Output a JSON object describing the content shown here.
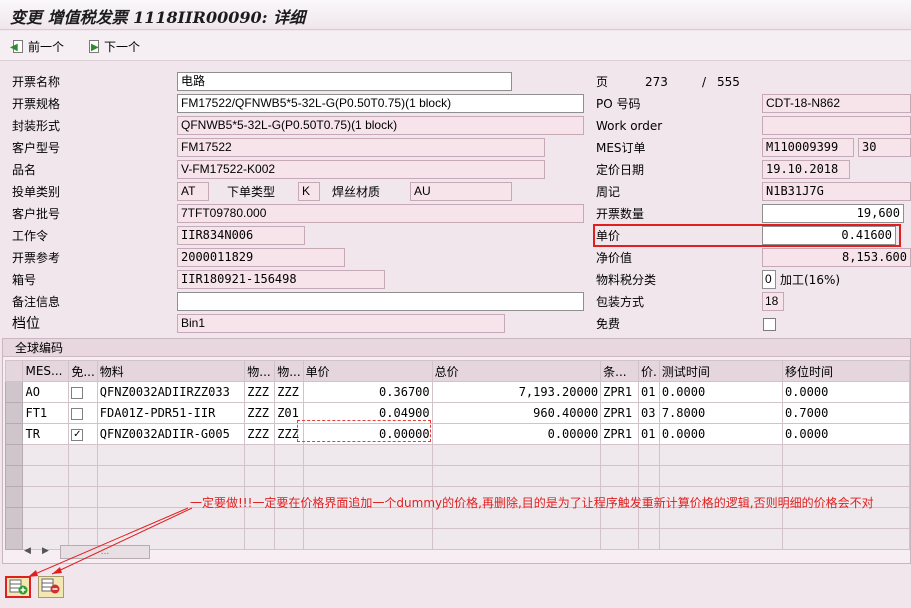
{
  "window": {
    "title": "变更 增值税发票 1118IIR00090: 详细"
  },
  "toolbar": {
    "prev_label": "前一个",
    "next_label": "下一个"
  },
  "form": {
    "invoice_name": {
      "label": "开票名称",
      "value": "电路"
    },
    "invoice_spec": {
      "label": "开票规格",
      "value": "FM17522/QFNWB5*5-32L-G(P0.50T0.75)(1 block)"
    },
    "package_form": {
      "label": "封装形式",
      "value": "QFNWB5*5-32L-G(P0.50T0.75)(1 block)"
    },
    "customer_model": {
      "label": "客户型号",
      "value": "FM17522"
    },
    "product_name": {
      "label": "品名",
      "value": "V-FM17522-K002"
    },
    "order_type": {
      "label": "投单类别",
      "value": "AT",
      "sub_label": "下单类型",
      "sub_value": "K",
      "wire_label": "焊丝材质",
      "wire_value": "AU"
    },
    "customer_batch": {
      "label": "客户批号",
      "value": "7TFT09780.000"
    },
    "work_order": {
      "label": "工作令",
      "value": "IIR834N006"
    },
    "invoice_ref": {
      "label": "开票参考",
      "value": "2000011829"
    },
    "box_no": {
      "label": "箱号",
      "value": "IIR180921-156498"
    },
    "remarks": {
      "label": "备注信息",
      "value": ""
    },
    "bin": {
      "label": "档位",
      "value": "Bin1"
    },
    "page": {
      "label": "页",
      "current": "273",
      "separator": "/",
      "total": "555"
    },
    "po_no": {
      "label": "PO 号码",
      "value": "CDT-18-N862"
    },
    "work_order_r": {
      "label": "Work order",
      "value": ""
    },
    "mes_order": {
      "label": "MES订单",
      "value": "M110009399",
      "value2": "30"
    },
    "price_date": {
      "label": "定价日期",
      "value": "19.10.2018"
    },
    "week": {
      "label": "周记",
      "value": "N1B31J7G"
    },
    "invoice_qty": {
      "label": "开票数量",
      "value": "19,600"
    },
    "unit_price": {
      "label": "单价",
      "value": "0.41600"
    },
    "net_value": {
      "label": "净价值",
      "value": "8,153.600"
    },
    "tax_class": {
      "label": "物料税分类",
      "value": "0",
      "desc": "加工(16%)"
    },
    "packing": {
      "label": "包装方式",
      "value": "18"
    },
    "free": {
      "label": "免费",
      "checked": false
    }
  },
  "section": {
    "title": "全球编码"
  },
  "grid": {
    "headers": [
      "MES...",
      "免...",
      "物料",
      "物...",
      "物...",
      "单价",
      "总价",
      "条...",
      "价.",
      "测试时间",
      "移位时间"
    ],
    "rows": [
      {
        "mes": "AO",
        "free": false,
        "material": "QFNZ0032ADIIRZZ033",
        "m1": "ZZZ",
        "m2": "ZZZ",
        "unit": "0.36700",
        "total": "7,193.20000",
        "cond": "ZPR1",
        "p": "01",
        "test": "0.0000",
        "shift": "0.0000"
      },
      {
        "mes": "FT1",
        "free": false,
        "material": "FDA01Z-PDR51-IIR",
        "m1": "ZZZ",
        "m2": "Z01",
        "unit": "0.04900",
        "total": "960.40000",
        "cond": "ZPR1",
        "p": "03",
        "test": "7.8000",
        "shift": "0.7000"
      },
      {
        "mes": "TR",
        "free": true,
        "material": "QFNZ0032ADIIR-G005",
        "m1": "ZZZ",
        "m2": "ZZZ",
        "unit": "0.00000",
        "total": "0.00000",
        "cond": "ZPR1",
        "p": "01",
        "test": "0.0000",
        "shift": "0.0000"
      }
    ]
  },
  "annotation": "一定要做!!!一定要在价格界面追加一个dummy的价格,再删除,目的是为了让程序触发重新计算价格的逻辑,否则明细的价格会不对",
  "scroll": {
    "thumb_label": "..."
  },
  "colors": {
    "highlight": "#e02020",
    "field_bg": "#f7e4ea"
  }
}
